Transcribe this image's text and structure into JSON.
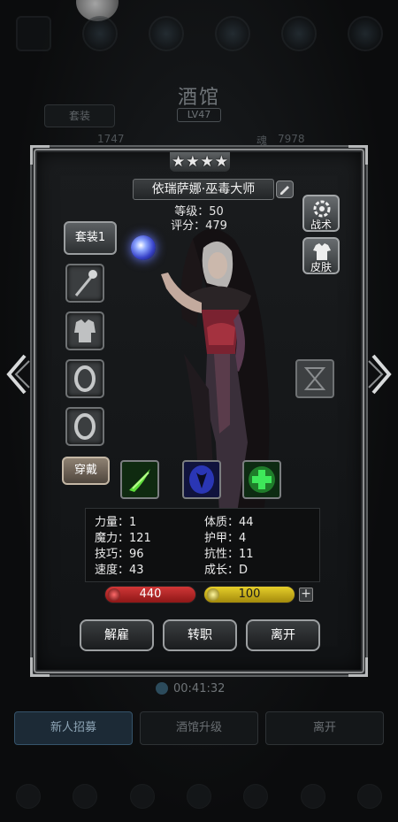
{
  "background": {
    "title": "酒馆",
    "level": "LV47",
    "set_tab": "套装",
    "left_stat": "1747",
    "right_stat_label": "魂",
    "right_stat_value": "7978",
    "timer": "00:41:32",
    "bottom_buttons": [
      "新人招募",
      "酒馆升级",
      "离开"
    ],
    "nav_labels": [
      "",
      "",
      "",
      "",
      "",
      ""
    ]
  },
  "hero": {
    "stars": 4,
    "name": "依瑞萨娜·巫毒大师",
    "level_line": "等级：50",
    "score_line": "评分：479",
    "set_button": "套装1",
    "wear_button": "穿戴",
    "tactics_button": "战术",
    "skin_button": "皮肤",
    "stats": [
      {
        "label": "力量：1"
      },
      {
        "label": "体质：44"
      },
      {
        "label": "魔力：121"
      },
      {
        "label": "护甲：4"
      },
      {
        "label": "技巧：96"
      },
      {
        "label": "抗性：11"
      },
      {
        "label": "速度：43"
      },
      {
        "label": "成长：D"
      }
    ],
    "hp": "440",
    "energy": "100",
    "plus": "+",
    "actions": [
      "解雇",
      "转职",
      "离开"
    ]
  },
  "icons": {
    "equip_slots": [
      "staff-icon",
      "armor-icon",
      "ring-icon",
      "ring-icon"
    ],
    "skills": [
      "green-slash-icon",
      "dark-spirit-icon",
      "green-cross-icon"
    ]
  },
  "colors": {
    "hp": "#c12a2a",
    "energy": "#d9c01f",
    "panel_border": "#8d8f90",
    "wear_button": "#8e8172"
  }
}
